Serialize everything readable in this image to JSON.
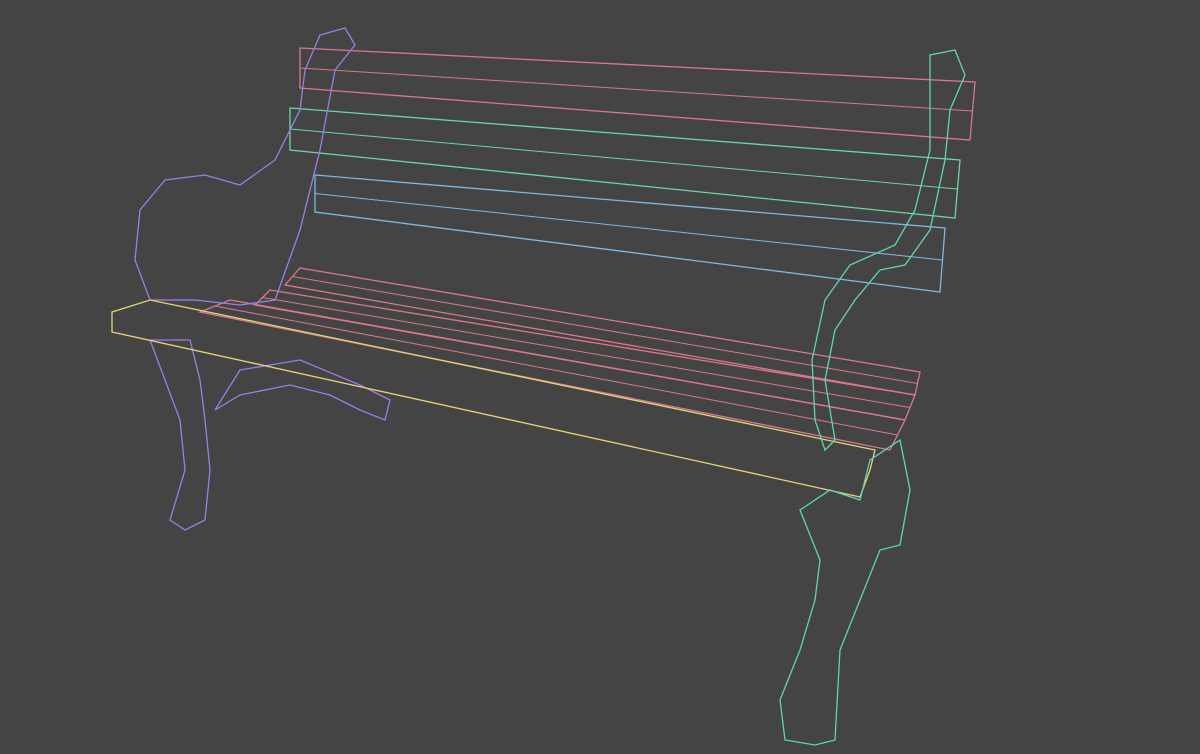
{
  "viewport": {
    "background": "#444444"
  },
  "colors": {
    "back_slat_top": "#d9788a",
    "back_slat_mid": "#6fd6a2",
    "back_slat_low": "#7fb7e0",
    "seat_slats": "#d9788a",
    "front_seat_slat": "#e6d27a",
    "left_frame": "#9a7fe6",
    "right_frame": "#5fd6b0"
  }
}
